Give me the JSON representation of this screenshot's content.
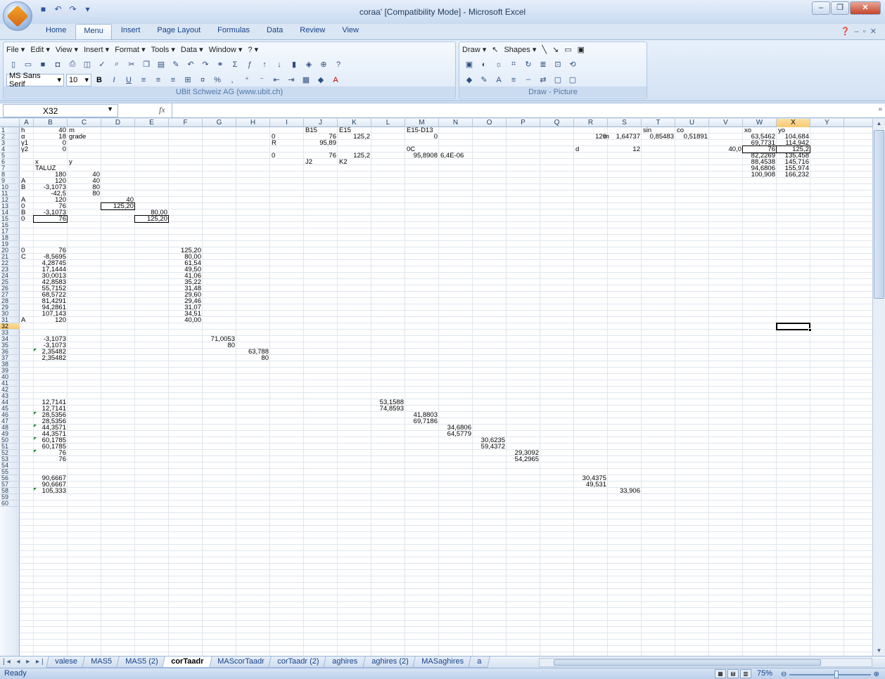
{
  "window": {
    "title": "coraa'  [Compatibility Mode] - Microsoft Excel"
  },
  "ribbon_tabs": [
    "Home",
    "Menu",
    "Insert",
    "Page Layout",
    "Formulas",
    "Data",
    "Review",
    "View"
  ],
  "active_tab": "Menu",
  "menus": [
    "File",
    "Edit",
    "View",
    "Insert",
    "Format",
    "Tools",
    "Data",
    "Window",
    "?"
  ],
  "draw_menus": [
    "Draw",
    "Shapes"
  ],
  "font": {
    "name": "MS Sans Serif",
    "size": "10"
  },
  "group_caption_main": "UBit Schweiz AG   (www.ubit.ch)",
  "group_caption_draw": "Draw - Picture",
  "name_box": "X32",
  "formula_fx": "fx",
  "formula": "",
  "columns": [
    "A",
    "B",
    "C",
    "D",
    "E",
    "F",
    "G",
    "H",
    "I",
    "J",
    "K",
    "L",
    "M",
    "N",
    "O",
    "P",
    "Q",
    "R",
    "S",
    "T",
    "U",
    "V",
    "W",
    "X",
    "Y"
  ],
  "selected_column": "X",
  "selected_row": "32",
  "sheet_tabs": [
    "valese",
    "MAS5",
    "MAS5 (2)",
    "corTaadr",
    "MAScorTaadr",
    "corTaadr (2)",
    "aghires",
    "aghires (2)",
    "MASaghires",
    "a"
  ],
  "active_sheet": "corTaadr",
  "status": {
    "ready": "Ready",
    "zoom": "75%"
  },
  "cells": [
    [
      "A",
      1,
      "h"
    ],
    [
      "B",
      1,
      "40",
      "r"
    ],
    [
      "C",
      1,
      "m"
    ],
    [
      "J",
      1,
      "B15"
    ],
    [
      "K",
      1,
      "E15"
    ],
    [
      "M",
      1,
      "E15-D13"
    ],
    [
      "T",
      1,
      "sin"
    ],
    [
      "U",
      1,
      "co"
    ],
    [
      "W",
      1,
      "xo"
    ],
    [
      "X",
      1,
      "yo"
    ],
    [
      "A",
      2,
      "α"
    ],
    [
      "B",
      2,
      "18",
      "r"
    ],
    [
      "C",
      2,
      "grade"
    ],
    [
      "I",
      2,
      "0"
    ],
    [
      "J",
      2,
      "76",
      "r"
    ],
    [
      "K",
      2,
      "125,2",
      "r"
    ],
    [
      "M",
      2,
      "0",
      "r"
    ],
    [
      "R",
      2,
      "120",
      "r"
    ],
    [
      "R2",
      2,
      "m"
    ],
    [
      "S",
      2,
      "1,64737",
      "r"
    ],
    [
      "T",
      2,
      "0,85483",
      "r"
    ],
    [
      "U",
      2,
      "0,51891",
      "r"
    ],
    [
      "W",
      2,
      "63,5462",
      "r"
    ],
    [
      "X",
      2,
      "104,684",
      "r"
    ],
    [
      "A",
      3,
      "γ1"
    ],
    [
      "B",
      3,
      "0",
      "r"
    ],
    [
      "I",
      3,
      "R"
    ],
    [
      "J",
      3,
      "95,89",
      "r"
    ],
    [
      "W",
      3,
      "69,7731",
      "r"
    ],
    [
      "X",
      3,
      "114,942",
      "r"
    ],
    [
      "A",
      4,
      "γ2"
    ],
    [
      "B",
      4,
      "0",
      "r"
    ],
    [
      "M",
      4,
      "0C"
    ],
    [
      "R",
      4,
      "d"
    ],
    [
      "S",
      4,
      "12",
      "r"
    ],
    [
      "V",
      4,
      "40,0",
      "r"
    ],
    [
      "W",
      4,
      "76",
      "r"
    ],
    [
      "X",
      4,
      "125,2",
      "r"
    ],
    [
      "I",
      5,
      "0"
    ],
    [
      "J",
      5,
      "76",
      "r"
    ],
    [
      "K",
      5,
      "125,2",
      "r"
    ],
    [
      "M",
      5,
      "95,8908",
      "r"
    ],
    [
      "N",
      5,
      "6,4E-06"
    ],
    [
      "W",
      5,
      "82,2269",
      "r"
    ],
    [
      "X",
      5,
      "135,458",
      "r"
    ],
    [
      "B",
      6,
      "x"
    ],
    [
      "C",
      6,
      "y"
    ],
    [
      "J",
      6,
      "J2"
    ],
    [
      "K",
      6,
      "K2"
    ],
    [
      "W",
      6,
      "88,4538",
      "r"
    ],
    [
      "X",
      6,
      "145,716",
      "r"
    ],
    [
      "B",
      7,
      "TALUZ"
    ],
    [
      "W",
      7,
      "94,6806",
      "r"
    ],
    [
      "X",
      7,
      "155,974",
      "r"
    ],
    [
      "B",
      8,
      "180",
      "r"
    ],
    [
      "C",
      8,
      "40",
      "r"
    ],
    [
      "W",
      8,
      "100,908",
      "r"
    ],
    [
      "X",
      8,
      "166,232",
      "r"
    ],
    [
      "A",
      9,
      "A"
    ],
    [
      "B",
      9,
      "120",
      "r"
    ],
    [
      "C",
      9,
      "40",
      "r"
    ],
    [
      "A",
      10,
      "B"
    ],
    [
      "B",
      10,
      "-3,1073",
      "r"
    ],
    [
      "C",
      10,
      "80",
      "r"
    ],
    [
      "B",
      11,
      "-42,5",
      "r"
    ],
    [
      "C",
      11,
      "80",
      "r"
    ],
    [
      "A",
      12,
      "A"
    ],
    [
      "B",
      12,
      "120",
      "r"
    ],
    [
      "D",
      12,
      "40",
      "r"
    ],
    [
      "A",
      13,
      "0"
    ],
    [
      "B",
      13,
      "76",
      "r"
    ],
    [
      "D",
      13,
      "125,20",
      "r"
    ],
    [
      "A",
      14,
      "B"
    ],
    [
      "B",
      14,
      "-3,1073",
      "r"
    ],
    [
      "E",
      14,
      "80,00",
      "r"
    ],
    [
      "A",
      15,
      "0"
    ],
    [
      "B",
      15,
      "76",
      "r"
    ],
    [
      "E",
      15,
      "125,20",
      "r"
    ],
    [
      "A",
      20,
      "0"
    ],
    [
      "B",
      20,
      "76",
      "r"
    ],
    [
      "F",
      20,
      "125,20",
      "r"
    ],
    [
      "A",
      21,
      "C"
    ],
    [
      "B",
      21,
      "-8,5695",
      "r"
    ],
    [
      "F",
      21,
      "80,00",
      "r"
    ],
    [
      "B",
      22,
      "4,28745",
      "r"
    ],
    [
      "F",
      22,
      "61,54",
      "r"
    ],
    [
      "B",
      23,
      "17,1444",
      "r"
    ],
    [
      "F",
      23,
      "49,50",
      "r"
    ],
    [
      "B",
      24,
      "30,0013",
      "r"
    ],
    [
      "F",
      24,
      "41,06",
      "r"
    ],
    [
      "B",
      25,
      "42,8583",
      "r"
    ],
    [
      "F",
      25,
      "35,22",
      "r"
    ],
    [
      "B",
      26,
      "55,7152",
      "r"
    ],
    [
      "F",
      26,
      "31,48",
      "r"
    ],
    [
      "B",
      27,
      "68,5722",
      "r"
    ],
    [
      "F",
      27,
      "29,60",
      "r"
    ],
    [
      "B",
      28,
      "81,4291",
      "r"
    ],
    [
      "F",
      28,
      "29,46",
      "r"
    ],
    [
      "B",
      29,
      "94,2861",
      "r"
    ],
    [
      "F",
      29,
      "31,07",
      "r"
    ],
    [
      "B",
      30,
      "107,143",
      "r"
    ],
    [
      "F",
      30,
      "34,51",
      "r"
    ],
    [
      "A",
      31,
      "A"
    ],
    [
      "B",
      31,
      "120",
      "r"
    ],
    [
      "F",
      31,
      "40,00",
      "r"
    ],
    [
      "B",
      34,
      "-3,1073",
      "r"
    ],
    [
      "G",
      34,
      "71,0053",
      "r"
    ],
    [
      "B",
      35,
      "-3,1073",
      "r"
    ],
    [
      "G",
      35,
      "80",
      "r"
    ],
    [
      "B",
      36,
      "2,35482",
      "r"
    ],
    [
      "H",
      36,
      "63,788",
      "r"
    ],
    [
      "B",
      37,
      "2,35482",
      "r"
    ],
    [
      "H",
      37,
      "80",
      "r"
    ],
    [
      "B",
      44,
      "12,7141",
      "r"
    ],
    [
      "L",
      44,
      "53,1588",
      "r"
    ],
    [
      "B",
      45,
      "12,7141",
      "r"
    ],
    [
      "L",
      45,
      "74,8593",
      "r"
    ],
    [
      "B",
      46,
      "28,5356",
      "r"
    ],
    [
      "M",
      46,
      "41,8803",
      "r"
    ],
    [
      "B",
      47,
      "28,5356",
      "r"
    ],
    [
      "M",
      47,
      "69,7186",
      "r"
    ],
    [
      "B",
      48,
      "44,3571",
      "r"
    ],
    [
      "N",
      48,
      "34,6806",
      "r"
    ],
    [
      "B",
      49,
      "44,3571",
      "r"
    ],
    [
      "N",
      49,
      "64,5779",
      "r"
    ],
    [
      "B",
      50,
      "60,1785",
      "r"
    ],
    [
      "O",
      50,
      "30,6235",
      "r"
    ],
    [
      "B",
      51,
      "60,1785",
      "r"
    ],
    [
      "O",
      51,
      "59,4372",
      "r"
    ],
    [
      "B",
      52,
      "76",
      "r"
    ],
    [
      "P",
      52,
      "29,3092",
      "r"
    ],
    [
      "B",
      53,
      "76",
      "r"
    ],
    [
      "P",
      53,
      "54,2965",
      "r"
    ],
    [
      "B",
      56,
      "90,6667",
      "r"
    ],
    [
      "R",
      56,
      "30,4375",
      "r"
    ],
    [
      "B",
      57,
      "90,6667",
      "r"
    ],
    [
      "R",
      57,
      "49,531",
      "r"
    ],
    [
      "B",
      58,
      "105,333",
      "r"
    ],
    [
      "S",
      58,
      "33,906",
      "r"
    ]
  ],
  "boxed_cells": [
    [
      "D",
      13
    ],
    [
      "E",
      15
    ],
    [
      "B",
      15
    ],
    [
      "W",
      4
    ],
    [
      "X",
      4
    ]
  ],
  "green_marks": [
    [
      "B",
      36
    ],
    [
      "B",
      46
    ],
    [
      "B",
      48
    ],
    [
      "B",
      50
    ],
    [
      "B",
      52
    ],
    [
      "B",
      58
    ]
  ]
}
